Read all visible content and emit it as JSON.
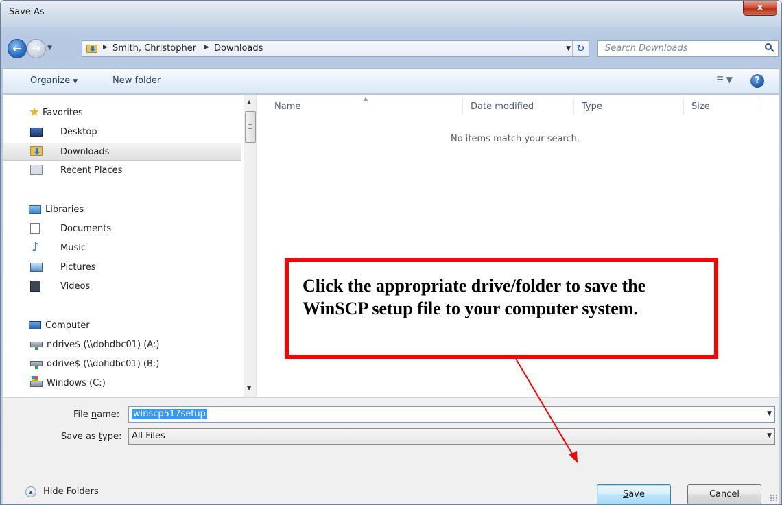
{
  "window": {
    "title": "Save As",
    "close_label": "x"
  },
  "address": {
    "crumbs": [
      "Smith, Christopher",
      "Downloads"
    ],
    "search_placeholder": "Search Downloads"
  },
  "toolbar": {
    "organize_label": "Organize",
    "new_folder_label": "New folder"
  },
  "nav": {
    "favorites": {
      "label": "Favorites",
      "items": [
        "Desktop",
        "Downloads",
        "Recent Places"
      ],
      "selected": "Downloads"
    },
    "libraries": {
      "label": "Libraries",
      "items": [
        "Documents",
        "Music",
        "Pictures",
        "Videos"
      ]
    },
    "computer": {
      "label": "Computer",
      "items": [
        "ndrive$ (\\\\dohdbc01) (A:)",
        "odrive$ (\\\\dohdbc01) (B:)",
        "Windows (C:)"
      ]
    }
  },
  "content": {
    "columns": [
      "Name",
      "Date modified",
      "Type",
      "Size"
    ],
    "empty_message": "No items match your search."
  },
  "form": {
    "file_name_label_pre": "File ",
    "file_name_label_u": "n",
    "file_name_label_post": "ame:",
    "file_name_value": "winscp517setup",
    "save_type_label_pre": "Save as ",
    "save_type_label_u": "t",
    "save_type_label_post": "ype:",
    "save_type_value": "All Files"
  },
  "footer": {
    "hide_folders_label": "Hide Folders",
    "save_label_u": "S",
    "save_label_post": "ave",
    "cancel_label": "Cancel"
  },
  "annotation": {
    "text": "Click the appropriate drive/folder to save the WinSCP setup file to your computer system.",
    "border_color": "#ff0000"
  }
}
